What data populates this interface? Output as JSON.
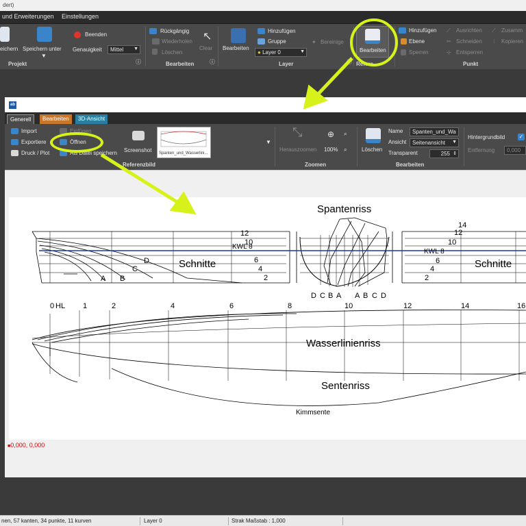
{
  "app": {
    "title_fragment": "dert)",
    "menu": [
      "und Erweiterungen",
      "Einstellungen"
    ]
  },
  "main_ribbon": {
    "projekt": {
      "label": "Projekt",
      "speichern": "eichern",
      "speichern_unter": "Speichern unter",
      "beenden": "Beenden",
      "genauigkeit_label": "Genauigkeit",
      "genauigkeit_value": "Mittel"
    },
    "bearbeiten": {
      "label": "Bearbeiten",
      "rueckgaengig": "Rückgängig",
      "wiederholen": "Wiederholen",
      "loeschen": "Löschen",
      "clear": "Clear"
    },
    "layer": {
      "label": "Layer",
      "bearbeiten": "Bearbeiten",
      "hinzufuegen": "Hinzufügen",
      "gruppe": "Gruppe",
      "layer_value": "Layer 0",
      "bereinigen": "Bereinige"
    },
    "referenz": {
      "label": "Refere...",
      "bearbeiten": "Bearbeiten"
    },
    "punkt": {
      "label": "Punkt",
      "hinzufuegen": "Hinzufügen",
      "ebene": "Ebene",
      "sperren": "Sperren",
      "ausrichten": "Ausrichten",
      "schneiden": "Schneiden",
      "entsperren": "Entsperren",
      "zusamm": "Zusamm",
      "kopieren": "Kopieren"
    }
  },
  "inner_window": {
    "tabs": [
      {
        "label": "Generell",
        "color": "#2b2b2b"
      },
      {
        "label": "Bearbeiten",
        "color": "#c8762a"
      },
      {
        "label": "3D-Ansicht",
        "color": "#2a7fa0"
      }
    ],
    "ribbon": {
      "import": "Import",
      "exportieren": "Exportiere",
      "druck_plot": "Druck / Plot",
      "einfuegen": "Einfügen",
      "oeffnen": "Öffnen",
      "als_datei": "Als Datei speichern",
      "screenshot": "Screenshot",
      "thumbnail_caption": "Spanten_und_Wasserlini...",
      "referenzbild_label": "Referenzbild",
      "herauszoomen": "Herauszoomen",
      "zoom_value": "100%",
      "zoomen_label": "Zoomen",
      "loeschen": "Löschen",
      "name_label": "Name",
      "name_value": "Spanten_und_Wa",
      "ansicht_label": "Ansicht",
      "ansicht_value": "Seitenansicht",
      "transparent_label": "Transparent",
      "transparent_value": "255",
      "bearbeiten_label": "Bearbeiten",
      "hintergrundbild": "Hintergrundbild",
      "entfernung_label": "Entfernung",
      "entfernung_value": "0,000"
    },
    "drawing": {
      "spantenriss": "Spantenriss",
      "schnitte": "Schnitte",
      "wasserlinienriss": "Wasserlinienriss",
      "sentenriss": "Sentenriss",
      "kimmsente": "Kimmsente",
      "kwl": "KWL 8",
      "wl_left": [
        "12",
        "10",
        "6",
        "4",
        "2"
      ],
      "wl_right": [
        "14",
        "12",
        "10",
        "6",
        "4",
        "2"
      ],
      "buttock_letters_left": [
        "A",
        "B",
        "C",
        "D"
      ],
      "body_letters": [
        "D",
        "C",
        "B",
        "A",
        "A",
        "B",
        "C",
        "D"
      ],
      "stations": [
        "0",
        "HL",
        "1",
        "2",
        "4",
        "6",
        "8",
        "10",
        "12",
        "14",
        "16"
      ]
    },
    "coords": "0,000, 0,000"
  },
  "status": {
    "counts": "nen, 57 kanten, 34 punkte, 11 kurven",
    "layer": "Layer 0",
    "scale": "Strak Maßstab : 1,000"
  },
  "colors": {
    "highlight": "#d7f21b",
    "ribbon": "#4a4a4a",
    "kwl_line": "#1a3a9a"
  }
}
